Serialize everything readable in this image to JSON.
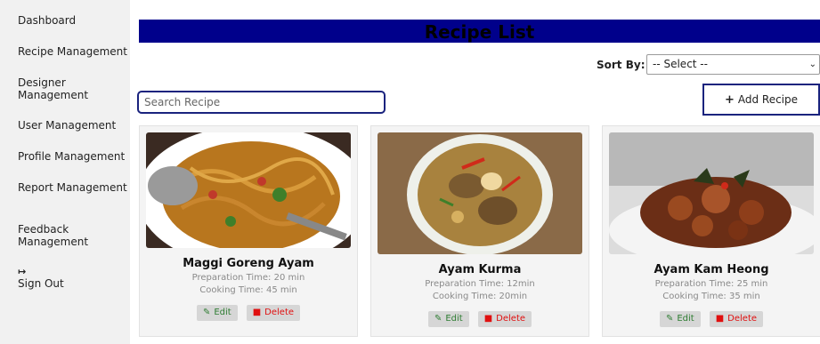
{
  "sidebar": {
    "items": [
      {
        "label": "Dashboard"
      },
      {
        "label": "Recipe Management"
      },
      {
        "label": "Designer\nManagement"
      },
      {
        "label": "User Management"
      },
      {
        "label": "Profile Management"
      },
      {
        "label": "Report Management"
      },
      {
        "label": "Feedback\nManagement"
      }
    ],
    "signout": {
      "icon": "sign-out-icon",
      "label": "Sign Out"
    }
  },
  "header": {
    "title": "Recipe List"
  },
  "sort": {
    "label": "Sort By:",
    "selected": "-- Select --"
  },
  "search": {
    "placeholder": "Search Recipe"
  },
  "add_button": {
    "label": "Add Recipe",
    "icon": "plus-icon"
  },
  "recipes": [
    {
      "name": "Maggi Goreng Ayam",
      "prep": "Preparation Time: 20 min",
      "cook": "Cooking Time: 45 min",
      "edit_label": "Edit",
      "delete_label": "Delete"
    },
    {
      "name": "Ayam Kurma",
      "prep": "Preparation Time: 12min",
      "cook": "Cooking Time: 20min",
      "edit_label": "Edit",
      "delete_label": "Delete"
    },
    {
      "name": "Ayam Kam Heong",
      "prep": "Preparation Time: 25 min",
      "cook": "Cooking Time: 35 min",
      "edit_label": "Edit",
      "delete_label": "Delete"
    }
  ],
  "colors": {
    "header_bar": "#00008b",
    "border_accent": "#1a237e",
    "edit_text": "#2e7d32",
    "delete_text": "#e01010"
  }
}
